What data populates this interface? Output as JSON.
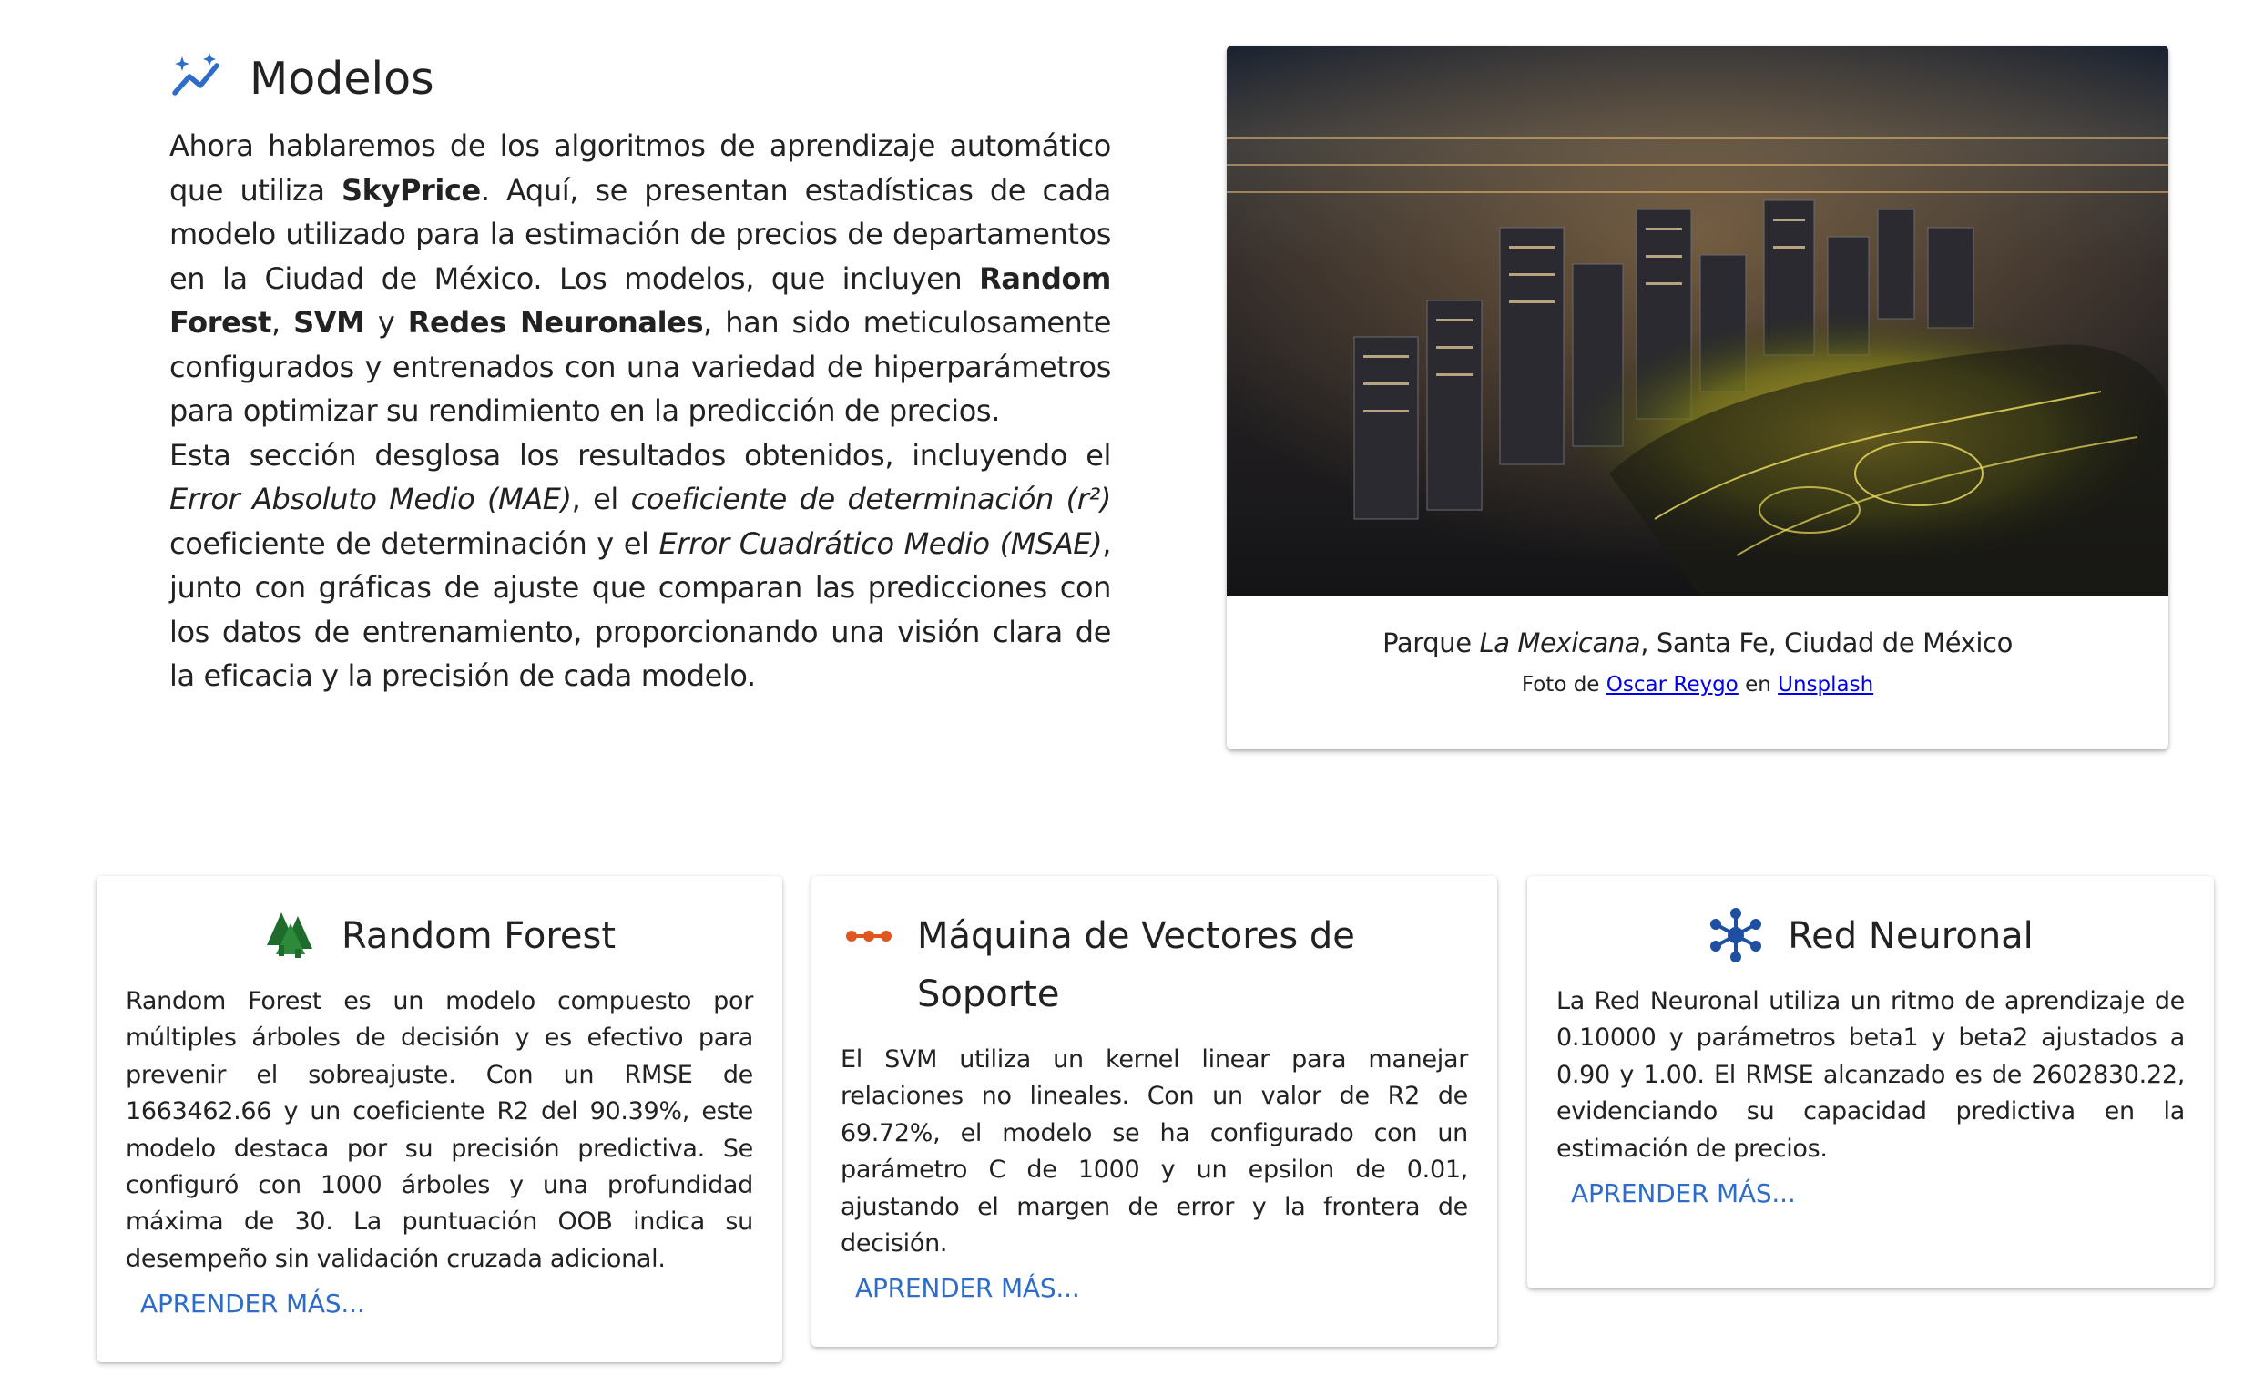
{
  "intro": {
    "title": "Modelos",
    "icon": "auto-graph-icon",
    "accent": "#2d6cc9",
    "p1_a": "Ahora hablaremos de los algoritmos de aprendizaje automático que utiliza ",
    "p1_brand": "SkyPrice",
    "p1_b": ". Aquí, se presentan estadísticas de cada modelo utilizado para la estimación de precios de departamentos en la Ciudad de México. Los modelos, que incluyen ",
    "p1_m1": "Random Forest",
    "p1_c": ", ",
    "p1_m2": "SVM",
    "p1_d": " y ",
    "p1_m3": "Redes Neuronales",
    "p1_e": ", han sido meticulosamente configurados y entrenados con una variedad de hiperparámetros para optimizar su rendimiento en la predicción de precios.",
    "p2_a": "Esta sección desglosa los resultados obtenidos, incluyendo el ",
    "p2_i1": "Error Absoluto Medio (MAE)",
    "p2_b": ", el ",
    "p2_i2": "coeficiente de determinación (r²)",
    "p2_c": " coeficiente de determinación y el ",
    "p2_i3": "Error Cuadrático Medio (MSAE)",
    "p2_d": ", junto con gráficas de ajuste que comparan las predicciones con los datos de entrenamiento, proporcionando una visión clara de la eficacia y la precisión de cada modelo."
  },
  "photo": {
    "caption_a": "Parque ",
    "caption_italic": "La Mexicana",
    "caption_b": ", Santa Fe, Ciudad de México",
    "credit_a": "Foto de ",
    "credit_author": "Oscar Reygo",
    "credit_b": " en ",
    "credit_site": "Unsplash"
  },
  "cards": [
    {
      "title": "Random Forest",
      "icon": "forest-icon",
      "icon_color": "#1f6b2b",
      "text": "Random Forest es un modelo compuesto por múltiples árboles de decisión y es efectivo para prevenir el sobreajuste. Con un RMSE de 1663462.66 y un coeficiente R2 del 90.39%, este modelo destaca por su precisión predictiva. Se configuró con 1000 árboles y una profundidad máxima de 30. La puntuación OOB indica su desempeño sin validación cruzada adicional.",
      "link": "APRENDER MÁS..."
    },
    {
      "title": "Máquina de Vectores de Soporte",
      "icon": "linear-scale-icon",
      "icon_color": "#e0561f",
      "text": "El SVM utiliza un kernel linear para manejar relaciones no lineales. Con un valor de R2 de 69.72%, el modelo se ha configurado con un parámetro C de 1000 y un epsilon de 0.01, ajustando el margen de error y la frontera de decisión.",
      "link": "APRENDER MÁS..."
    },
    {
      "title": "Red Neuronal",
      "icon": "hub-icon",
      "icon_color": "#1f4fa0",
      "text": "La Red Neuronal utiliza un ritmo de aprendizaje de 0.10000 y parámetros beta1 y beta2 ajustados a 0.90 y 1.00. El RMSE alcanzado es de 2602830.22, evidenciando su capacidad predictiva en la estimación de precios.",
      "link": "APRENDER MÁS..."
    }
  ]
}
